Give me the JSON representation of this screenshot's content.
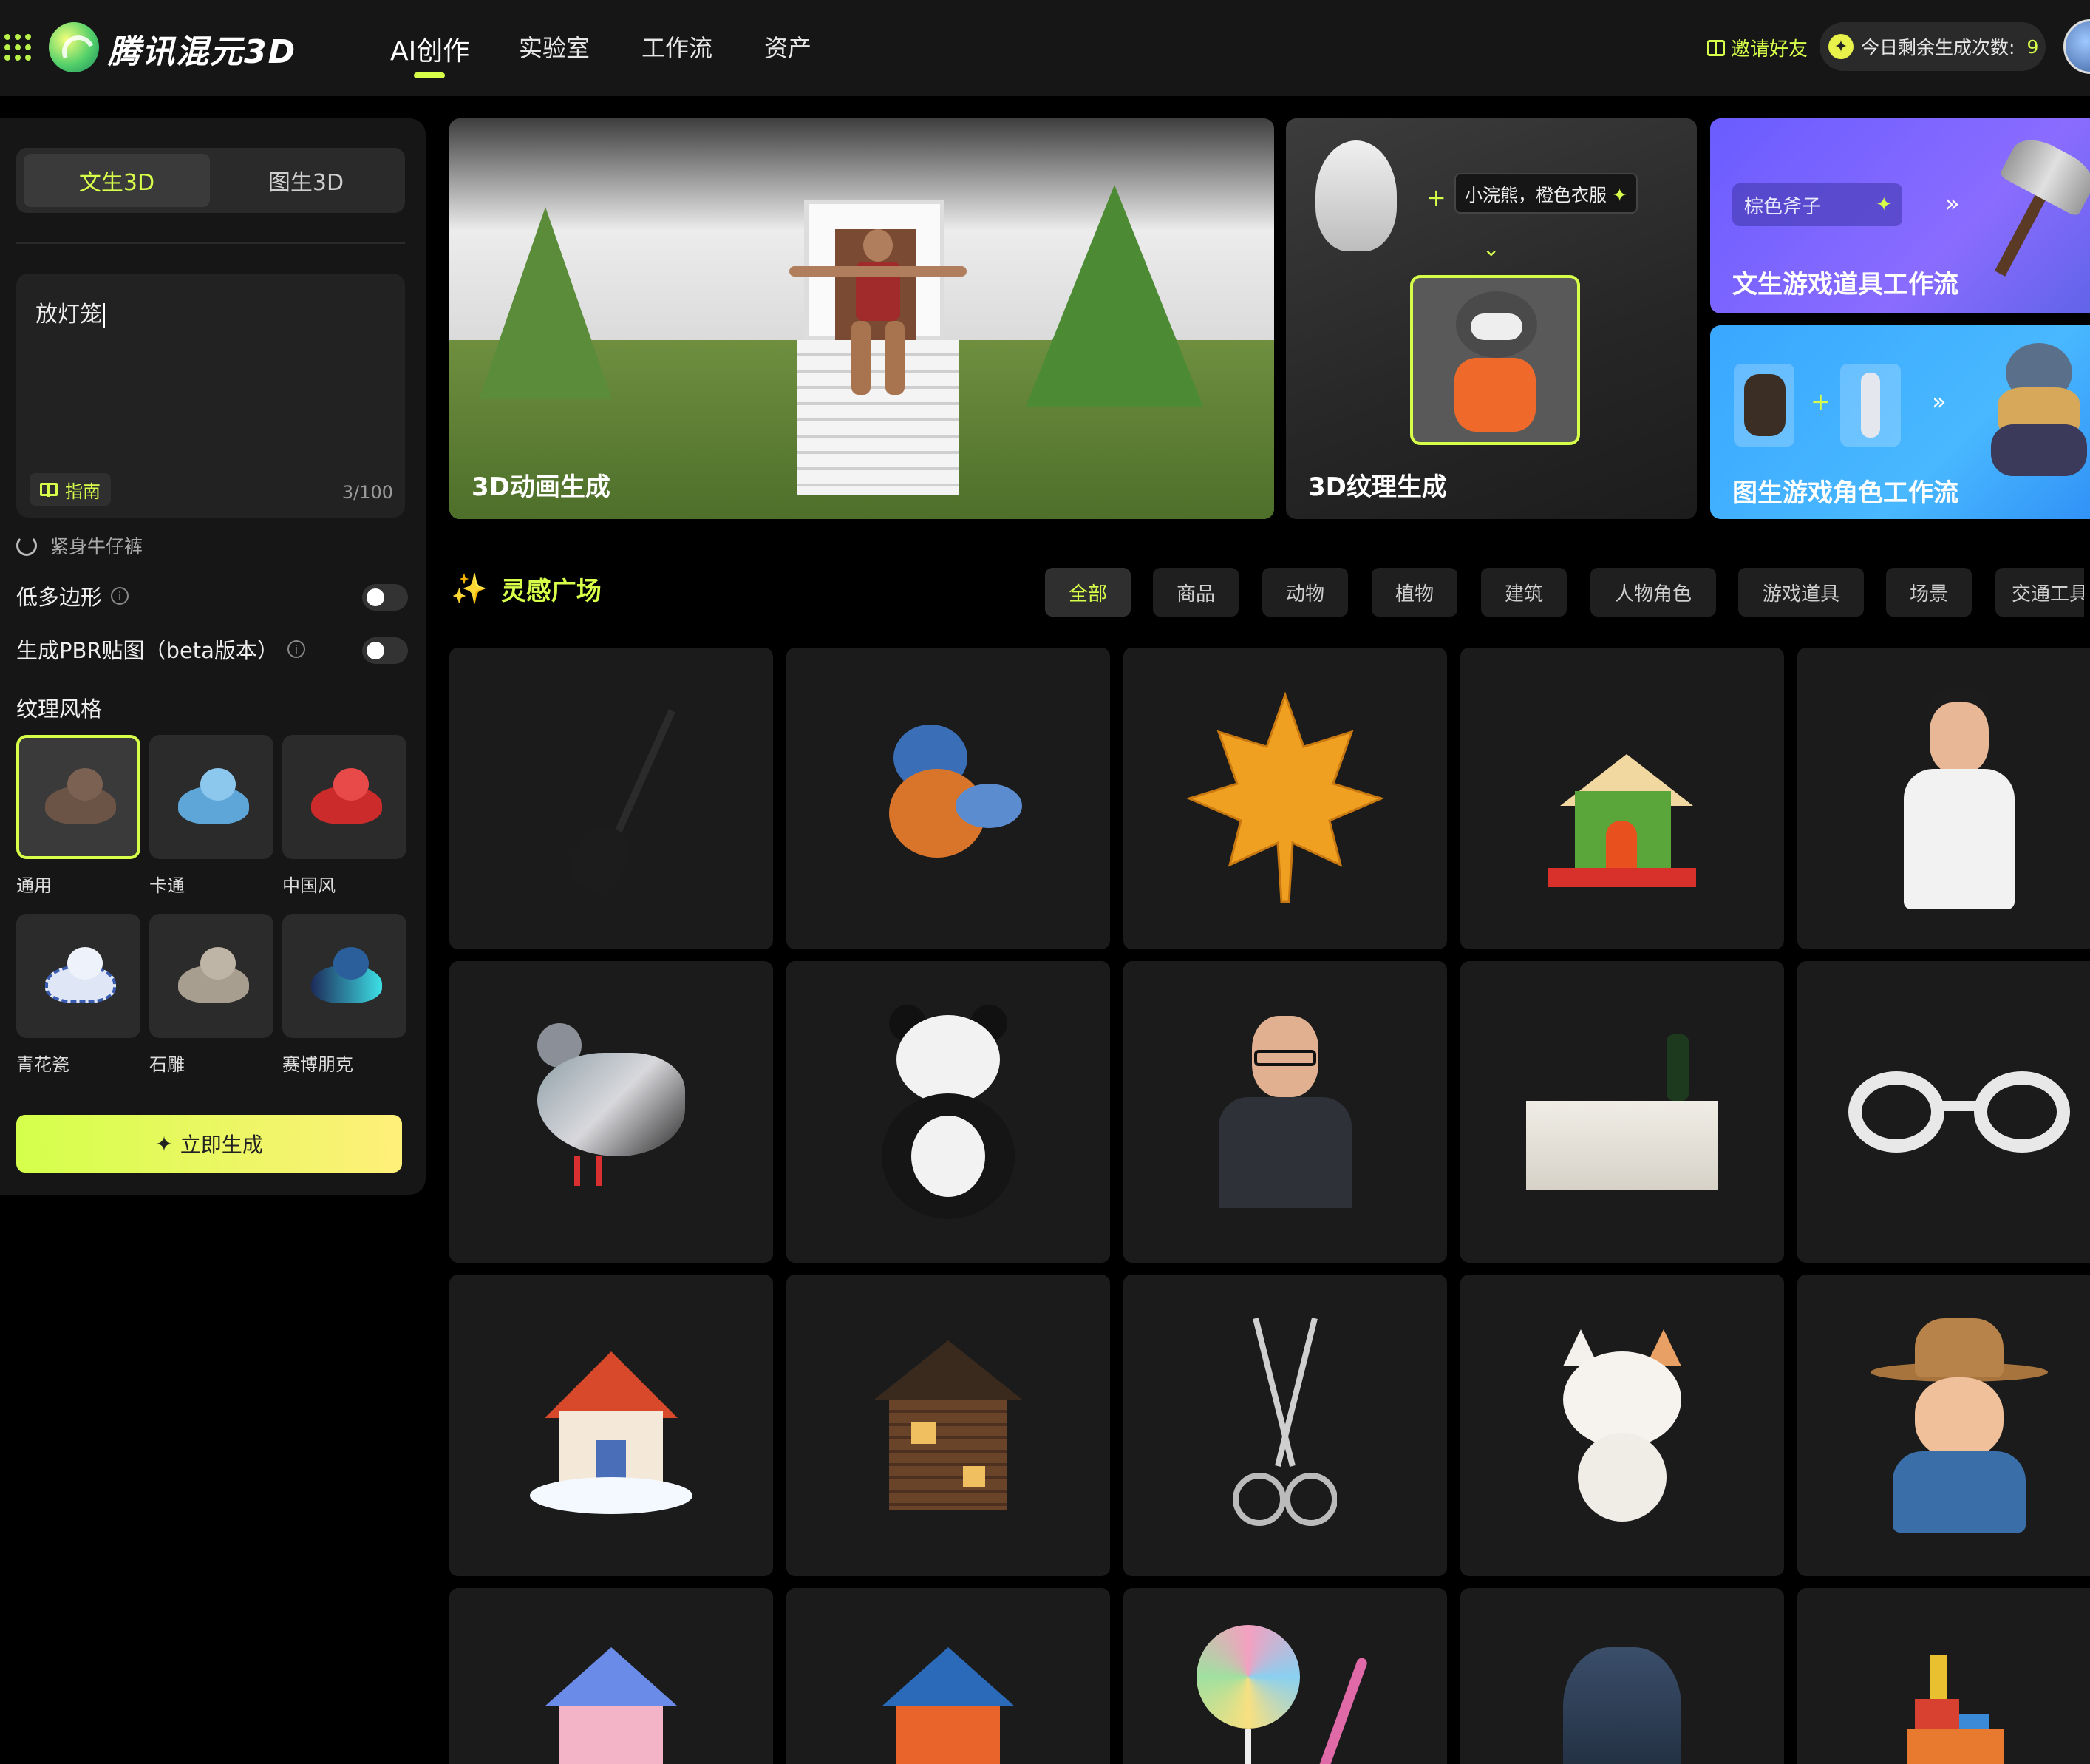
{
  "header": {
    "brand": "腾讯混元3D",
    "nav": [
      "AI创作",
      "实验室",
      "工作流",
      "资产"
    ],
    "invite": "邀请好友",
    "quota_label": "今日剩余生成次数:",
    "quota_count": "9"
  },
  "panel": {
    "tab_text3d": "文生3D",
    "tab_image3d": "图生3D",
    "prompt_value": "放灯笼",
    "guide": "指南",
    "counter": "3/100",
    "suggestion": "紧身牛仔裤",
    "low_poly": "低多边形",
    "pbr": "生成PBR贴图（beta版本）",
    "texture_title": "纹理风格",
    "styles": [
      "通用",
      "卡通",
      "中国风",
      "青花瓷",
      "石雕",
      "赛博朋克"
    ],
    "generate": "立即生成"
  },
  "banners": {
    "animation": "3D动画生成",
    "texture": "3D纹理生成",
    "texture_prompt": "小浣熊，橙色衣服",
    "prop_chip": "棕色斧子",
    "prop_workflow": "文生游戏道具工作流",
    "char_workflow": "图生游戏角色工作流"
  },
  "gallery": {
    "title": "灵感广场",
    "filters": [
      "全部",
      "商品",
      "动物",
      "植物",
      "建筑",
      "人物角色",
      "游戏道具",
      "场景",
      "交通工具"
    ]
  },
  "icons": {
    "apps": "apps-grid-icon",
    "gift": "gift-icon",
    "coin": "coin-icon",
    "book": "book-icon",
    "refresh": "refresh-icon",
    "info": "info-icon",
    "sparkle": "sparkle-icon"
  },
  "colors": {
    "accent": "#d7ff4a",
    "bg": "#000000",
    "panel": "#161616"
  }
}
